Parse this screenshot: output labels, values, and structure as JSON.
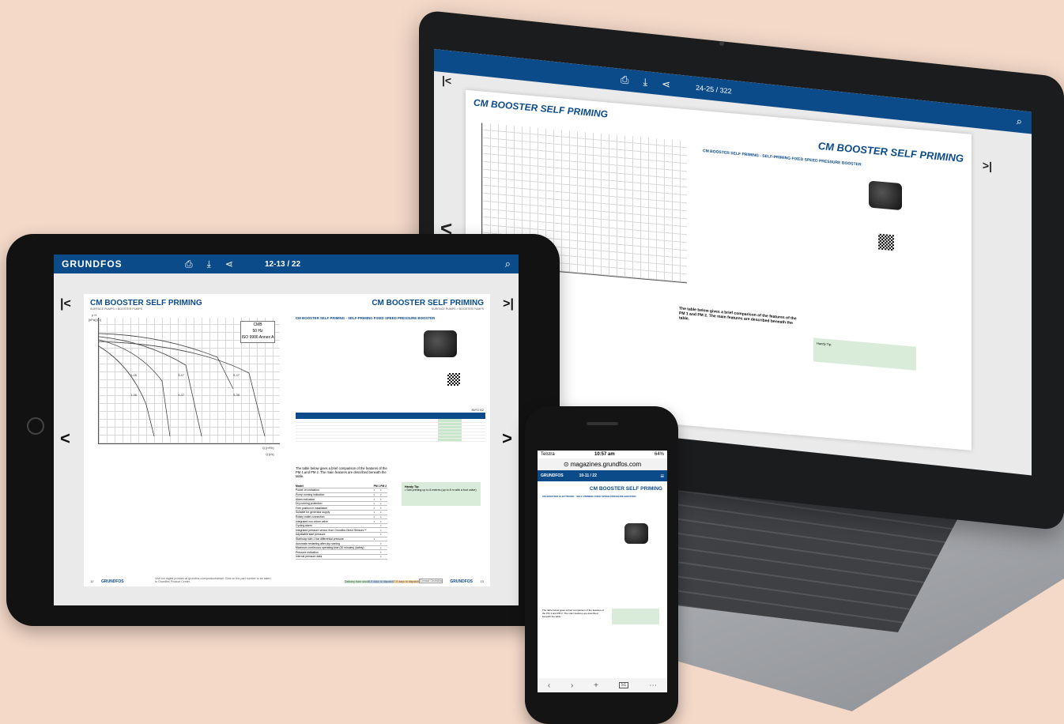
{
  "brand": {
    "logo": "GRUNDFOS",
    "accent": "#0c4b8a",
    "green": "#c8e6c9"
  },
  "laptop": {
    "pager": "24-25 / 322",
    "title_left": "CM BOOSTER SELF PRIMING",
    "title_right": "CM BOOSTER SELF PRIMING",
    "section": "CM BOOSTER SELF PRIMING - SELF-PRIMING FIXED SPEED PRESSURE BOOSTER",
    "comparison_text": "The table below gives a brief comparison of the features of the PM 1 and PM 2. The main features are described beneath the table.",
    "handy_tip": "Handy Tip:"
  },
  "tablet": {
    "pager": "12-13 / 22",
    "title_left": "CM BOOSTER SELF PRIMING",
    "subtitle_left": "SURFACE PUMPS > BOOSTER PUMPS",
    "title_right": "CM BOOSTER SELF PRIMING",
    "subtitle_right": "SURFACE PUMPS > BOOSTER PUMPS",
    "section": "CM BOOSTER SELF PRIMING - SELF-PRIMING FIXED SPEED PRESSURE BOOSTER",
    "chart_box": [
      "CMB",
      "50 Hz",
      "ISO 9906 Annex A"
    ],
    "chart_ylabel": "p  H",
    "chart_yunit": "[kPa] [m]",
    "chart_xunit_top": "Q [m³/h]",
    "chart_xunit_bottom": "Q [l/s]",
    "curves": [
      "1-45",
      "3-47",
      "5-47",
      "1-36",
      "3-37",
      "5-36"
    ],
    "pm_table_code": "INFO B2",
    "comparison_text": "The table below gives a brief comparison of the features of the PM 1 and PM 2. The main features are described beneath the table.",
    "cmp_header": [
      "Model",
      "PM 1",
      "PM 2"
    ],
    "cmp_rows": [
      "Power-on indication",
      "Pump running indication",
      "Alarm indication",
      "Dry-running protection",
      "Free position in installation",
      "Suitable for generator supply",
      "Rotary outlet connection",
      "Integrated non-return valve",
      "Cycling alarm",
      "Integrated pressure sensor from Grundfos Direct Sensors™",
      "Adjustable start pressure",
      "Start/stop with 1 bar differential pressure",
      "Automatic restarting after dry-running",
      "Maximum continuous operating time (30 minutes) (safety)",
      "Pressure indication",
      "Internal pressure data"
    ],
    "handy_tip": "Handy Tip:",
    "handy_text": "• Self-priming up to 8 metres (up to 8 m with a foot valve)",
    "footer_left": "Visit our digital provider at grundfos.com/product/detail. Click on the part number to be taken to Grundfos Product Center.",
    "footer_tags": [
      "Delivery from stock",
      "5-9 days to dispatch",
      "7-9 days to dispatch",
      "Contact Grundfos"
    ],
    "page_left": "12",
    "page_right": "13"
  },
  "phone": {
    "carrier": "Telstra",
    "time": "10:57 am",
    "battery": "64%",
    "url": "magazines.grundfos.com",
    "pager": "10-11 / 22",
    "title": "CM BOOSTER SELF PRIMING",
    "section": "CM BOOSTER ELECTRONIC - SELF-PRIMING FIXED SPEED PRESSURE BOOSTER",
    "comparison_text": "The table below gives a brief comparison of the features of the PM 1 and PM 2. The main features are described beneath the table.",
    "tabs": "51"
  }
}
